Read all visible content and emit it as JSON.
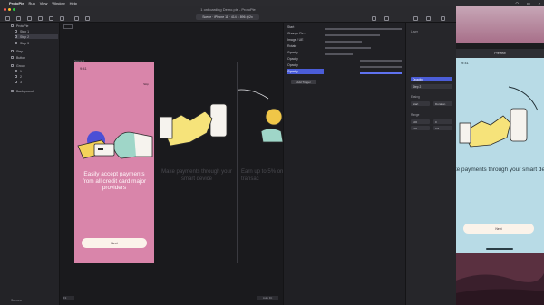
{
  "menubar": {
    "app": "ProtoPie",
    "items": [
      "Run",
      "View",
      "Window",
      "Help"
    ]
  },
  "window": {
    "doc_title": "1 onboarding Demo.pie - ProtoPie",
    "device": "Scene · iPhone 11 · 414 × 896 @2x"
  },
  "layers": {
    "items": [
      {
        "label": "ProtoPie",
        "selected": false
      },
      {
        "label": "Step 1",
        "selected": false
      },
      {
        "label": "Step 2",
        "selected": true
      },
      {
        "label": "Step 3",
        "selected": false
      },
      {
        "label": "Step",
        "selected": false
      },
      {
        "label": "Button",
        "selected": false
      },
      {
        "label": "Group",
        "selected": false
      },
      {
        "label": "1",
        "selected": false
      },
      {
        "label": "2",
        "selected": false
      },
      {
        "label": "3",
        "selected": false
      },
      {
        "label": "Background",
        "selected": false
      }
    ],
    "footer": "Scenes"
  },
  "canvas": {
    "scene_label": "Scene 1",
    "slide1_text": "Easily accept payments from all credit card major providers",
    "slide1_button": "Next",
    "slide2_text": "Make payments through your smart device",
    "slide3_text": "Earn up to 5% on transac",
    "status_time": "9:41",
    "skip": "Skip",
    "footer_left": "Fit",
    "footer_right": "Auto Fit"
  },
  "timeline": {
    "rows": [
      {
        "label": "Start",
        "selected": false
      },
      {
        "label": "Change Re...",
        "selected": false
      },
      {
        "label": "Image / UE",
        "selected": false
      },
      {
        "label": "Rotate",
        "selected": false
      },
      {
        "label": "Opacity",
        "selected": false
      },
      {
        "label": "Opacity",
        "selected": false
      },
      {
        "label": "Opacity",
        "selected": false
      },
      {
        "label": "Opacity",
        "selected": false
      }
    ],
    "add_trigger": "Add Trigger"
  },
  "inspector": {
    "trigger_label": "Layer",
    "trigger_value": "Opacity",
    "target": "Step 2",
    "section_easing": "Easing",
    "section_range": "Range",
    "fields": [
      "Start",
      "Duration",
      "100",
      "0",
      "100",
      "0.5"
    ]
  },
  "preview": {
    "title": "Preview",
    "status_time": "9:41",
    "text": "Make payments through your smart device",
    "button": "Next"
  }
}
